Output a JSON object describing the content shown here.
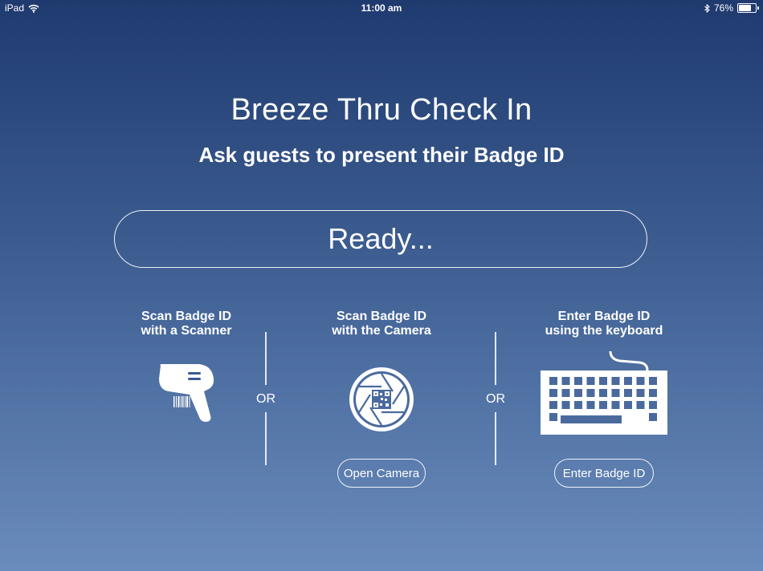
{
  "status_bar": {
    "device": "iPad",
    "time": "11:00 am",
    "battery_text": "76%",
    "battery_level": 0.76,
    "icons": [
      "wifi-icon",
      "bluetooth-icon",
      "battery-icon"
    ]
  },
  "header": {
    "title": "Breeze Thru Check In",
    "subtitle": "Ask guests to present their Badge ID"
  },
  "status_field": {
    "value": "Ready..."
  },
  "options": {
    "scanner": {
      "line1": "Scan Badge ID",
      "line2": "with a Scanner",
      "icon": "barcode-scanner-icon"
    },
    "camera": {
      "line1": "Scan Badge ID",
      "line2": "with the Camera",
      "icon": "camera-shutter-icon",
      "button_label": "Open Camera"
    },
    "keyboard": {
      "line1": "Enter Badge ID",
      "line2": "using the keyboard",
      "icon": "keyboard-icon",
      "button_label": "Enter Badge ID"
    }
  },
  "separators": {
    "left": "OR",
    "right": "OR"
  },
  "colors": {
    "background_top": "#1f3a6e",
    "background_bottom": "#6a8cbc",
    "foreground": "#ffffff"
  }
}
